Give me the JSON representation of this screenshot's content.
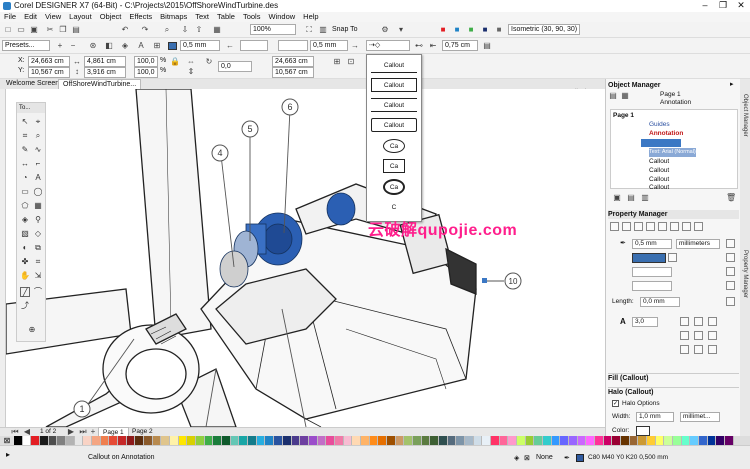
{
  "app": {
    "title": "Corel DESIGNER X7 (64-Bit) - C:\\Projects\\2015\\OffShoreWindTurbine.des",
    "window_controls": [
      "–",
      "❐",
      "✕"
    ]
  },
  "menu": [
    "File",
    "Edit",
    "View",
    "Layout",
    "Object",
    "Effects",
    "Bitmaps",
    "Text",
    "Table",
    "Tools",
    "Window",
    "Help"
  ],
  "toolbar1": {
    "zoom": "100%",
    "snap_to": "Snap To",
    "projection": "Isometric (30, 90, 30)"
  },
  "toolbar2": {
    "presets": "Presets...",
    "outline_width": "0,5 mm",
    "outline_width2": "0,5 mm",
    "callout_width": "0,75 cm"
  },
  "toolbar3": {
    "x": "24,663 cm",
    "y": "10,567 cm",
    "w": "4,861 cm",
    "h": "3,916 cm",
    "scale_w": "100,0",
    "scale_h": "100,0",
    "scale_unit": "%",
    "angle": "0,0",
    "x2": "24,663 cm",
    "y2": "10,567 cm"
  },
  "tabs": [
    "Welcome Screen",
    "OffShoreWindTurbine..."
  ],
  "toolbox": {
    "title": "To..."
  },
  "ruler_unit": "centimeters",
  "callout_menu": [
    "Callout",
    "Callout",
    "Callout",
    "Callout",
    "Ca",
    "Ca",
    "Ca",
    "C"
  ],
  "illustration": {
    "callouts": [
      "1",
      "4",
      "5",
      "6",
      "10"
    ]
  },
  "watermark": "云破解qupojie.com",
  "object_manager": {
    "title": "Object Manager",
    "page_label": "Page 1",
    "layer_label": "Annotation",
    "tree": [
      "Page 1",
      "Guides",
      "Annotation",
      "Text: Arial (Normal)",
      "Callout",
      "Callout",
      "Callout",
      "Callout"
    ]
  },
  "property_manager": {
    "title": "Property Manager",
    "width": "0,5 mm",
    "units": "millimeters",
    "length_label": "Length:",
    "length": "0,0 mm",
    "font_size": "3,0",
    "fill_section": "Fill (Callout)",
    "halo_section": "Halo (Callout)",
    "halo_options": "Halo Options",
    "halo_width_label": "Width:",
    "halo_width": "1,0 mm",
    "halo_units": "millimet...",
    "color_label": "Color:"
  },
  "side_tabs": [
    "Object Manager",
    "Property Manager"
  ],
  "pages": {
    "indicator": "1 of 2",
    "page1": "Page 1",
    "page2": "Page 2"
  },
  "status": {
    "message": "Callout on Annotation",
    "fill": "None",
    "outline": "C80 M40 Y0 K20 0,500 mm"
  },
  "colors": {
    "accent": "#2a7fc6",
    "selection": "#3b78c4",
    "motor": "#2b5fb3",
    "fill_swatch": "#3a6fb0",
    "watermark": "#ff1e8c"
  },
  "palette": [
    "#000000",
    "#ffffff",
    "#e31e24",
    "#1a1a1a",
    "#4d4d4d",
    "#808080",
    "#b3b3b3",
    "#e6e6e6",
    "#f9d3c5",
    "#f4a582",
    "#ef7f4f",
    "#e64b35",
    "#c62828",
    "#8e1a1a",
    "#5c2e0f",
    "#8b5a2b",
    "#b88a4e",
    "#e0c58c",
    "#fff2a8",
    "#ffe600",
    "#d8d000",
    "#8fcf3f",
    "#3fae49",
    "#1b7d3b",
    "#0f5a2c",
    "#65c7b5",
    "#19a6a6",
    "#137c8b",
    "#26aee0",
    "#1f83c6",
    "#2953a0",
    "#1b2f6e",
    "#4a3a8c",
    "#6d3fa0",
    "#9b4dca",
    "#c26ec7",
    "#e84d9b",
    "#f07aa8",
    "#f8bcd2",
    "#ffd9b3",
    "#ffb366",
    "#ff8c1a",
    "#e66f00",
    "#9e4f00",
    "#cc9966",
    "#a3c26b",
    "#7aa05b",
    "#5b7b40",
    "#3d5f33",
    "#2f4f4f",
    "#556b7d",
    "#7d94a8",
    "#a7b9c9",
    "#cfdde8",
    "#e8f0f7",
    "#ff3366",
    "#ff6699",
    "#ff99cc",
    "#ccff66",
    "#99cc33",
    "#66cc99",
    "#33cccc",
    "#3399ff",
    "#6666ff",
    "#9966ff",
    "#cc66ff",
    "#ff66ff",
    "#ff3399",
    "#cc0066",
    "#990033",
    "#663300",
    "#996633",
    "#cc9933",
    "#ffcc33",
    "#ffff66",
    "#ccff99",
    "#99ff99",
    "#66ffcc",
    "#66ccff",
    "#3366cc",
    "#003399",
    "#330066",
    "#660066"
  ]
}
